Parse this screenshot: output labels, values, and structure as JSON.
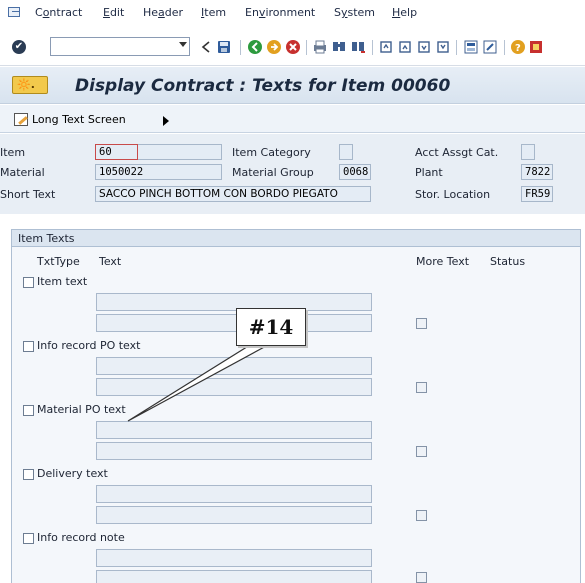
{
  "menu": {
    "items": [
      {
        "pre": "C",
        "acc": "o",
        "post": "ntract"
      },
      {
        "pre": "",
        "acc": "E",
        "post": "dit"
      },
      {
        "pre": "He",
        "acc": "a",
        "post": "der"
      },
      {
        "pre": "",
        "acc": "I",
        "post": "tem"
      },
      {
        "pre": "En",
        "acc": "v",
        "post": "ironment"
      },
      {
        "pre": "S",
        "acc": "y",
        "post": "stem"
      },
      {
        "pre": "",
        "acc": "H",
        "post": "elp"
      }
    ]
  },
  "toolbar": {
    "enter_glyph": "✔",
    "command_value": "",
    "icons": [
      "back-icon",
      "save-icon",
      "exit-icon",
      "cancel-icon",
      "print-icon",
      "find-icon",
      "find-next-icon",
      "first-page-icon",
      "prev-page-icon",
      "next-page-icon",
      "last-page-icon",
      "create-session-icon",
      "shortcut-icon",
      "help-icon",
      "layout-icon"
    ]
  },
  "title": {
    "text": "Display Contract : Texts for Item 00060",
    "icon_glyph": "🔆."
  },
  "app_toolbar": {
    "long_text_label": "Long Text Screen"
  },
  "header": {
    "item_label": "Item",
    "item_value": "60",
    "item_category_label": "Item Category",
    "item_category_value": "",
    "acct_assgt_label": "Acct Assgt Cat.",
    "acct_assgt_value": "",
    "material_label": "Material",
    "material_value": "1050022",
    "material_group_label": "Material Group",
    "material_group_value": "0068",
    "plant_label": "Plant",
    "plant_value": "7822",
    "short_text_label": "Short Text",
    "short_text_value": "SACCO PINCH BOTTOM CON BORDO PIEGATO",
    "stor_location_label": "Stor. Location",
    "stor_location_value": "FR59"
  },
  "item_texts": {
    "group_title": "Item Texts",
    "columns": {
      "txttype": "TxtType",
      "text": "Text",
      "more_text": "More Text",
      "status": "Status"
    },
    "rows": [
      {
        "label": "Item text"
      },
      {
        "label": "Info record PO text"
      },
      {
        "label": "Material PO text"
      },
      {
        "label": "Delivery text"
      },
      {
        "label": "Info record note"
      }
    ]
  },
  "callout": {
    "text": "#14"
  },
  "colors": {
    "title_bg": "#d8e3ef",
    "header_bg": "#e8eef5",
    "field_bg": "#e4ecf5",
    "item_field_border": "#c84a4a"
  }
}
